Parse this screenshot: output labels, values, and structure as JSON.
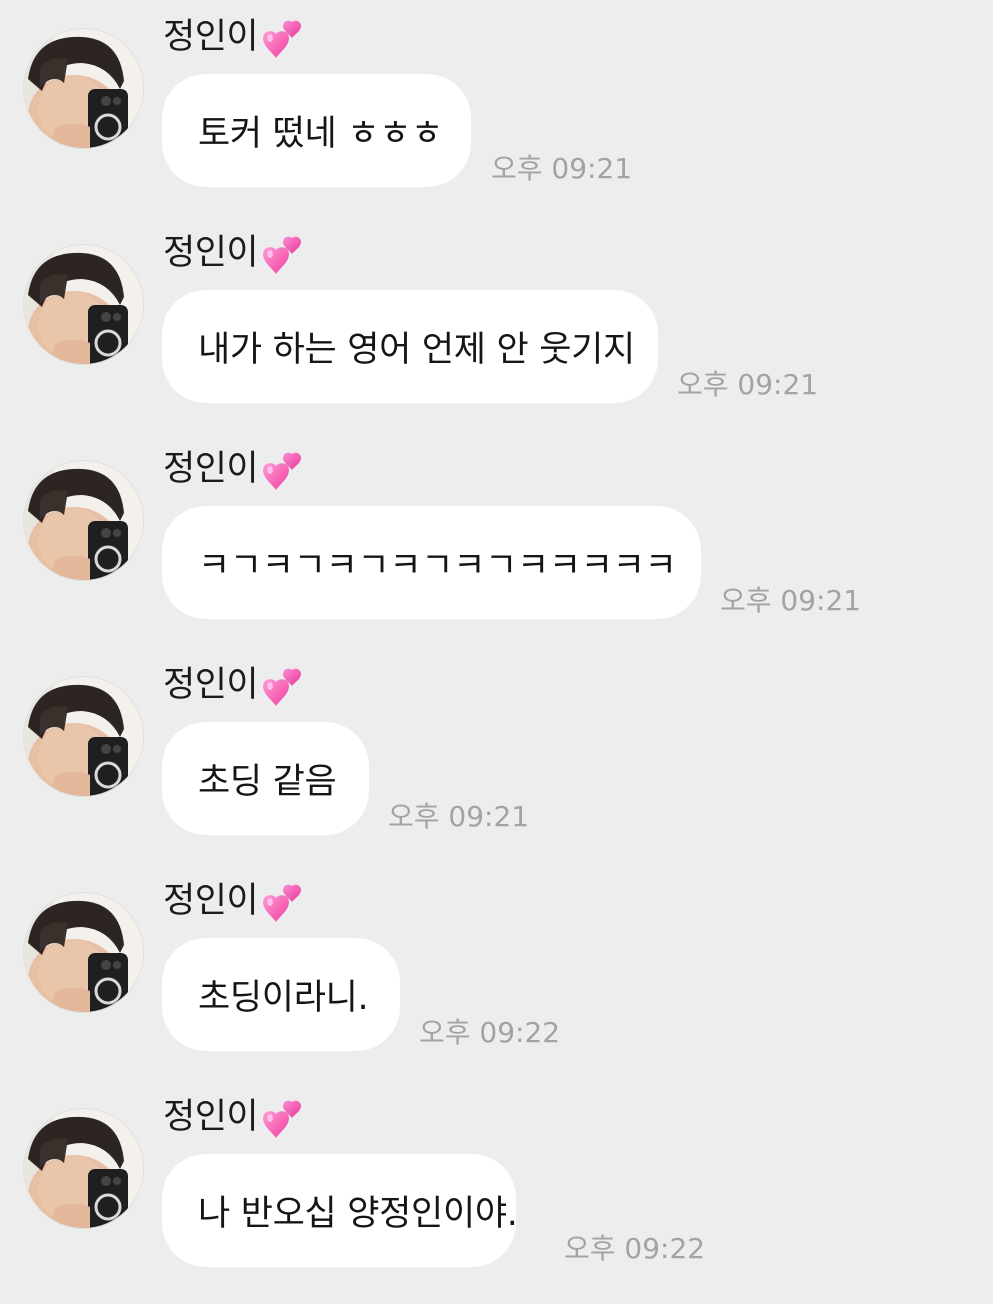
{
  "chat": {
    "sender_name": "정인이",
    "sender_emoji": "two-hearts-icon",
    "accent_color": "#ff5fb3",
    "messages": [
      {
        "text": "토커 떴네 ㅎㅎㅎ",
        "time": "오후 09:21"
      },
      {
        "text": "내가 하는 영어 언제 안 웃기지",
        "time": "오후 09:21"
      },
      {
        "text": "ㅋㄱㅋㄱㅋㄱㅋㄱㅋㄱㅋㅋㅋㅋㅋ",
        "time": "오후 09:21"
      },
      {
        "text": "초딩 같음",
        "time": "오후 09:21"
      },
      {
        "text": "초딩이라니.",
        "time": "오후 09:22"
      },
      {
        "text": "나 반오십 양정인이야.",
        "time": "오후 09:22"
      }
    ]
  }
}
